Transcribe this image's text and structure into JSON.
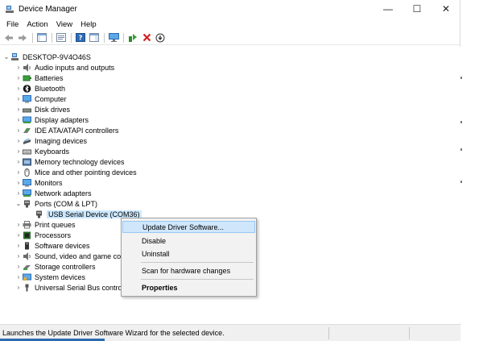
{
  "window": {
    "title": "Device Manager",
    "minimize": "—",
    "maximize": "☐",
    "close": "✕"
  },
  "menu": [
    "File",
    "Action",
    "View",
    "Help"
  ],
  "toolbar": {
    "icons": [
      "back-icon",
      "forward-icon",
      "show-hide-console-tree-icon",
      "properties-icon",
      "help-icon",
      "action-pane-icon",
      "monitor-icon",
      "update-driver-icon",
      "uninstall-icon",
      "download-icon"
    ]
  },
  "tree": {
    "root": "DESKTOP-9V4O46S",
    "categories": [
      "Audio inputs and outputs",
      "Batteries",
      "Bluetooth",
      "Computer",
      "Disk drives",
      "Display adapters",
      "IDE ATA/ATAPI controllers",
      "Imaging devices",
      "Keyboards",
      "Memory technology devices",
      "Mice and other pointing devices",
      "Monitors",
      "Network adapters",
      "Ports (COM & LPT)",
      "Print queues",
      "Processors",
      "Software devices",
      "Sound, video and game co",
      "Storage controllers",
      "System devices",
      "Universal Serial Bus contro"
    ],
    "ports_child": "USB Serial Device (COM36)"
  },
  "context_menu": {
    "update": "Update Driver Software...",
    "disable": "Disable",
    "uninstall": "Uninstall",
    "scan": "Scan for hardware changes",
    "properties": "Properties"
  },
  "status": "Launches the Update Driver Software Wizard for the selected device."
}
